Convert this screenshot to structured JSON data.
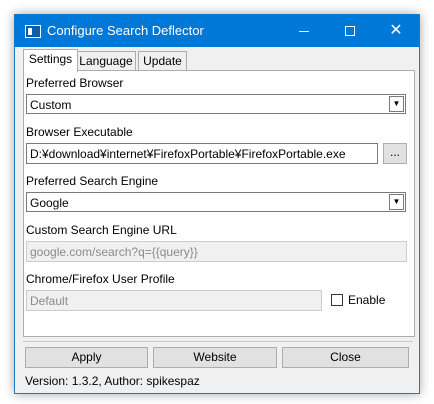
{
  "window": {
    "title": "Configure Search Deflector"
  },
  "tabs": [
    "Settings",
    "Language",
    "Update"
  ],
  "settings": {
    "preferred_browser_label": "Preferred Browser",
    "preferred_browser_value": "Custom",
    "browser_executable_label": "Browser Executable",
    "browser_executable_value": "D:¥download¥internet¥FirefoxPortable¥FirefoxPortable.exe",
    "browse_label": "...",
    "preferred_engine_label": "Preferred Search Engine",
    "preferred_engine_value": "Google",
    "custom_url_label": "Custom Search Engine URL",
    "custom_url_value": "google.com/search?q={{query}}",
    "profile_label": "Chrome/Firefox User Profile",
    "profile_value": "Default",
    "enable_label": "Enable"
  },
  "buttons": {
    "apply": "Apply",
    "website": "Website",
    "close": "Close"
  },
  "footer": {
    "version_text": "Version: 1.3.2, Author: spikespaz"
  },
  "icons": {
    "app": "app-window-icon",
    "minimize": "minimize-icon",
    "maximize": "maximize-icon",
    "close": "close-icon",
    "dropdown": "chevron-down-icon"
  },
  "colors": {
    "titlebar": "#0078d7",
    "window_bg": "#f0f0f0"
  }
}
